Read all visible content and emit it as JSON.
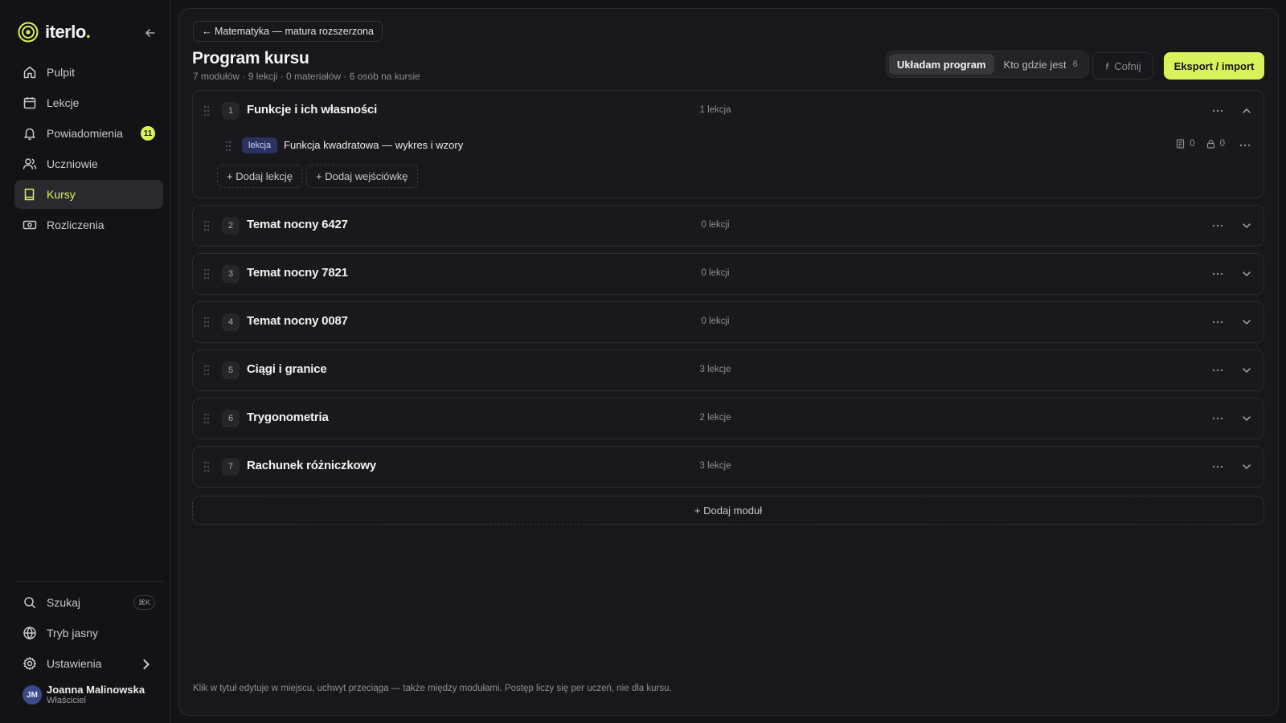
{
  "app": {
    "brand": "iterlo",
    "brand_dot": ".",
    "accent": "#d8f35a"
  },
  "sidebar": {
    "items": [
      {
        "label": "Pulpit",
        "icon": "home-icon"
      },
      {
        "label": "Lekcje",
        "icon": "calendar-icon"
      },
      {
        "label": "Powiadomienia",
        "icon": "bell-icon",
        "badge": "11"
      },
      {
        "label": "Uczniowie",
        "icon": "users-icon"
      },
      {
        "label": "Kursy",
        "icon": "book-icon",
        "active": true
      },
      {
        "label": "Rozliczenia",
        "icon": "billing-icon"
      }
    ],
    "bottom": {
      "search_label": "Szukaj",
      "search_shortcut": "⌘K",
      "theme_label": "Tryb jasny",
      "settings_label": "Ustawienia"
    },
    "user": {
      "initials": "JM",
      "name": "Joanna Malinowska",
      "role": "Właściciel"
    }
  },
  "header": {
    "back_label": "← Matematyka — matura rozszerzona",
    "title": "Program kursu",
    "stats": "7 modułów · 9 lekcji · 0 materiałów · 6 osób na kursie",
    "tabs": [
      {
        "label": "Układam program",
        "active": true
      },
      {
        "label": "Kto gdzie jest",
        "count": "6"
      }
    ],
    "undo_label": "Cofnij",
    "export_label": "Eksport / import"
  },
  "modules": [
    {
      "number": "1",
      "title": "Funkcje i ich własności",
      "count": "1 lekcja",
      "expanded": true,
      "lessons": [
        {
          "tag": "lekcja",
          "title": "Funkcja kwadratowa — wykres i wzory",
          "materials": "0",
          "locked": "0"
        }
      ],
      "add_lesson_label": "+ Dodaj lekcję",
      "add_quiz_label": "+ Dodaj wejściówkę"
    },
    {
      "number": "2",
      "title": "Temat nocny 6427",
      "count": "0 lekcji"
    },
    {
      "number": "3",
      "title": "Temat nocny 7821",
      "count": "0 lekcji"
    },
    {
      "number": "4",
      "title": "Temat nocny 0087",
      "count": "0 lekcji"
    },
    {
      "number": "5",
      "title": "Ciągi i granice",
      "count": "3 lekcje"
    },
    {
      "number": "6",
      "title": "Trygonometria",
      "count": "2 lekcje"
    },
    {
      "number": "7",
      "title": "Rachunek różniczkowy",
      "count": "3 lekcje"
    }
  ],
  "add_module_label": "+ Dodaj moduł",
  "footer_note": "Klik w tytuł edytuje w miejscu, uchwyt przeciąga — także między modułami. Postęp liczy się per uczeń, nie dla kursu."
}
